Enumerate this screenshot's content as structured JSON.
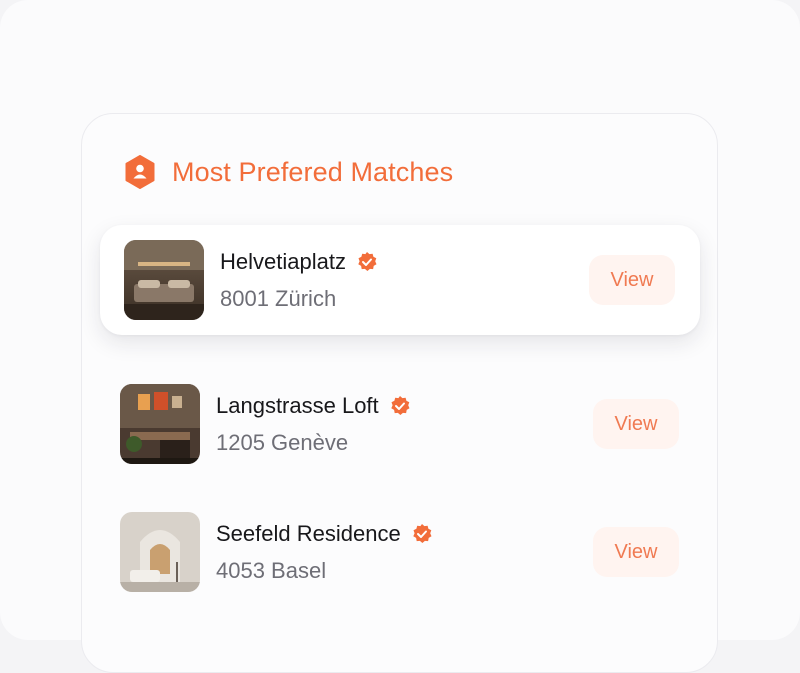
{
  "header": {
    "title": "Most Prefered Matches",
    "icon": "user-hexagon-icon"
  },
  "colors": {
    "accent": "#f26d3a",
    "view_bg": "#fff4f0",
    "view_text": "#f07a52"
  },
  "matches": [
    {
      "name": "Helvetiaplatz",
      "location": "8001 Zürich",
      "action": "View",
      "verified": true,
      "highlighted": true
    },
    {
      "name": "Langstrasse Loft",
      "location": "1205 Genève",
      "action": "View",
      "verified": true,
      "highlighted": false
    },
    {
      "name": "Seefeld Residence",
      "location": "4053 Basel",
      "action": "View",
      "verified": true,
      "highlighted": false
    }
  ]
}
